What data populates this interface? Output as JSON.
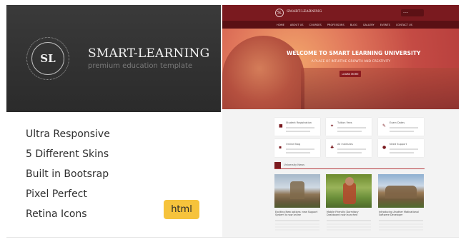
{
  "promo": {
    "logo_text": "SL",
    "title": "SMART-LEARNING",
    "subtitle": "premium education template",
    "features": [
      "Ultra Responsive",
      "5 Different Skins",
      "Built in Bootsrap",
      "Pixel Perfect",
      "Retina Icons"
    ],
    "badge": "html"
  },
  "site_preview": {
    "header": {
      "logo_text": "SL",
      "site_name": "SMART-LEARNING",
      "language_select": "-----",
      "nav_items": [
        "HOME",
        "ABOUT US",
        "COURSES",
        "PROFESSORS",
        "BLOG",
        "GALLERY",
        "EVENTS",
        "CONTACT US"
      ]
    },
    "hero": {
      "title": "WELCOME TO SMART LEARNING UNIVERSITY",
      "subtitle": "A PLACE OF INTUITIVE GROWTH AND CREATIVITY",
      "button": "LEARN MORE"
    },
    "feature_cards": [
      {
        "title": "Student Registration"
      },
      {
        "title": "Tuition Fees"
      },
      {
        "title": "Exam Dates"
      },
      {
        "title": "Online Blog"
      },
      {
        "title": "All Institutes"
      },
      {
        "title": "Need Support"
      }
    ],
    "news": {
      "header": "University News",
      "items": [
        {
          "title": "Exciting New options: new Support System is now online"
        },
        {
          "title": "Mobile Friendly: Dormitory Dashboard now launched"
        },
        {
          "title": "Introducing Another Motivational Software Developer"
        }
      ]
    }
  },
  "colors": {
    "accent": "#7a1a1f",
    "badge": "#f6c33c",
    "dark_panel": "#2b2b2b"
  }
}
